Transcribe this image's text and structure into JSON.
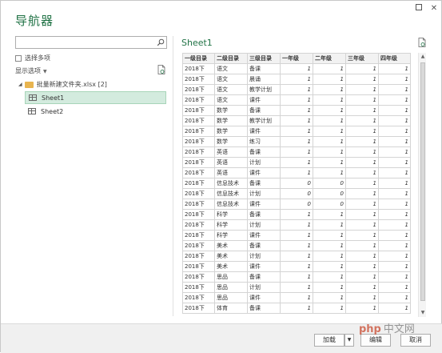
{
  "window": {
    "title": "导航器"
  },
  "left": {
    "search_placeholder": "",
    "multi_select_label": "选择多项",
    "display_options_label": "显示选项",
    "folder_label": "批量新建文件夹.xlsx [2]",
    "sheets": [
      "Sheet1",
      "Sheet2"
    ],
    "selected_sheet": "Sheet1"
  },
  "right": {
    "sheet_title": "Sheet1",
    "table": {
      "headers": [
        "一级目录",
        "二级目录",
        "三级目录",
        "一年级",
        "二年级",
        "三年级",
        "四年级"
      ],
      "rows": [
        [
          "2018下",
          "语文",
          "备课",
          "1",
          "1",
          "1",
          "1"
        ],
        [
          "2018下",
          "语文",
          "晨诵",
          "1",
          "1",
          "1",
          "1"
        ],
        [
          "2018下",
          "语文",
          "教学计划",
          "1",
          "1",
          "1",
          "1"
        ],
        [
          "2018下",
          "语文",
          "课件",
          "1",
          "1",
          "1",
          "1"
        ],
        [
          "2018下",
          "数学",
          "备课",
          "1",
          "1",
          "1",
          "1"
        ],
        [
          "2018下",
          "数学",
          "教学计划",
          "1",
          "1",
          "1",
          "1"
        ],
        [
          "2018下",
          "数学",
          "课件",
          "1",
          "1",
          "1",
          "1"
        ],
        [
          "2018下",
          "数学",
          "练习",
          "1",
          "1",
          "1",
          "1"
        ],
        [
          "2018下",
          "英语",
          "备课",
          "1",
          "1",
          "1",
          "1"
        ],
        [
          "2018下",
          "英语",
          "计划",
          "1",
          "1",
          "1",
          "1"
        ],
        [
          "2018下",
          "英语",
          "课件",
          "1",
          "1",
          "1",
          "1"
        ],
        [
          "2018下",
          "信息技术",
          "备课",
          "0",
          "0",
          "1",
          "1"
        ],
        [
          "2018下",
          "信息技术",
          "计划",
          "0",
          "0",
          "1",
          "1"
        ],
        [
          "2018下",
          "信息技术",
          "课件",
          "0",
          "0",
          "1",
          "1"
        ],
        [
          "2018下",
          "科学",
          "备课",
          "1",
          "1",
          "1",
          "1"
        ],
        [
          "2018下",
          "科学",
          "计划",
          "1",
          "1",
          "1",
          "1"
        ],
        [
          "2018下",
          "科学",
          "课件",
          "1",
          "1",
          "1",
          "1"
        ],
        [
          "2018下",
          "美术",
          "备课",
          "1",
          "1",
          "1",
          "1"
        ],
        [
          "2018下",
          "美术",
          "计划",
          "1",
          "1",
          "1",
          "1"
        ],
        [
          "2018下",
          "美术",
          "课件",
          "1",
          "1",
          "1",
          "1"
        ],
        [
          "2018下",
          "思品",
          "备课",
          "1",
          "1",
          "1",
          "1"
        ],
        [
          "2018下",
          "思品",
          "计划",
          "1",
          "1",
          "1",
          "1"
        ],
        [
          "2018下",
          "思品",
          "课件",
          "1",
          "1",
          "1",
          "1"
        ],
        [
          "2018下",
          "体育",
          "备课",
          "1",
          "1",
          "1",
          "1"
        ]
      ]
    }
  },
  "footer": {
    "load_label": "加载",
    "edit_label": "编辑",
    "cancel_label": "取消"
  },
  "watermark": {
    "logo": "php",
    "text": "中文网"
  },
  "colors": {
    "accent": "#217346",
    "selected_bg": "#d3ebde"
  }
}
